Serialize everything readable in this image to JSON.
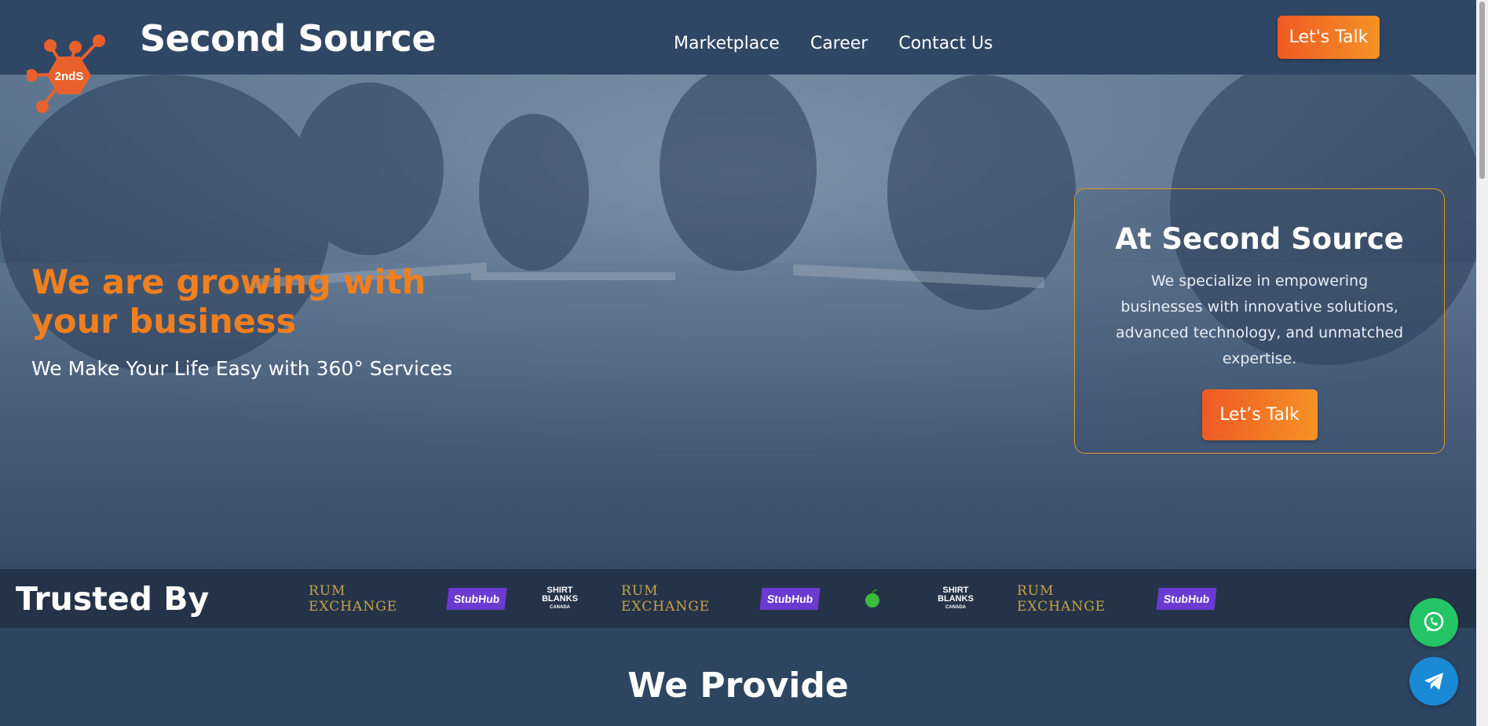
{
  "header": {
    "brand": "Second Source",
    "logo_text": "2ndS",
    "nav": [
      "Marketplace",
      "Career",
      "Contact Us"
    ],
    "cta_label": "Let's Talk"
  },
  "hero": {
    "title": "We are growing with your business",
    "subtitle": "We Make Your Life Easy with 360° Services",
    "card": {
      "title": "At Second Source",
      "text": "We specialize in empowering businesses with innovative solutions, advanced technology, and unmatched expertise.",
      "cta_label": "Let’s Talk"
    }
  },
  "trusted": {
    "title": "Trusted By",
    "logos": [
      {
        "name": "RUM EXCHANGE",
        "kind": "rum"
      },
      {
        "name": "StubHub",
        "kind": "stub"
      },
      {
        "name": "SHIRT BLANKS",
        "sub": "CANADA",
        "kind": "shirt"
      },
      {
        "name": "RUM EXCHANGE",
        "kind": "rum"
      },
      {
        "name": "StubHub",
        "kind": "stub"
      },
      {
        "name": "green-apple-logo",
        "kind": "apple"
      },
      {
        "name": "SHIRT BLANKS",
        "sub": "CANADA",
        "kind": "shirt"
      },
      {
        "name": "RUM EXCHANGE",
        "kind": "rum"
      },
      {
        "name": "StubHub",
        "kind": "stub"
      }
    ]
  },
  "provide": {
    "title": "We Provide"
  },
  "floating": [
    "whatsapp-icon",
    "telegram-icon"
  ],
  "colors": {
    "header_bg": "#2f4664",
    "accent_orange": "#f07f1f",
    "button_gradient_start": "#ee5a24",
    "button_gradient_end": "#f59225",
    "trusted_bg": "#243348",
    "whatsapp": "#25c466",
    "telegram": "#1a8ad6"
  }
}
